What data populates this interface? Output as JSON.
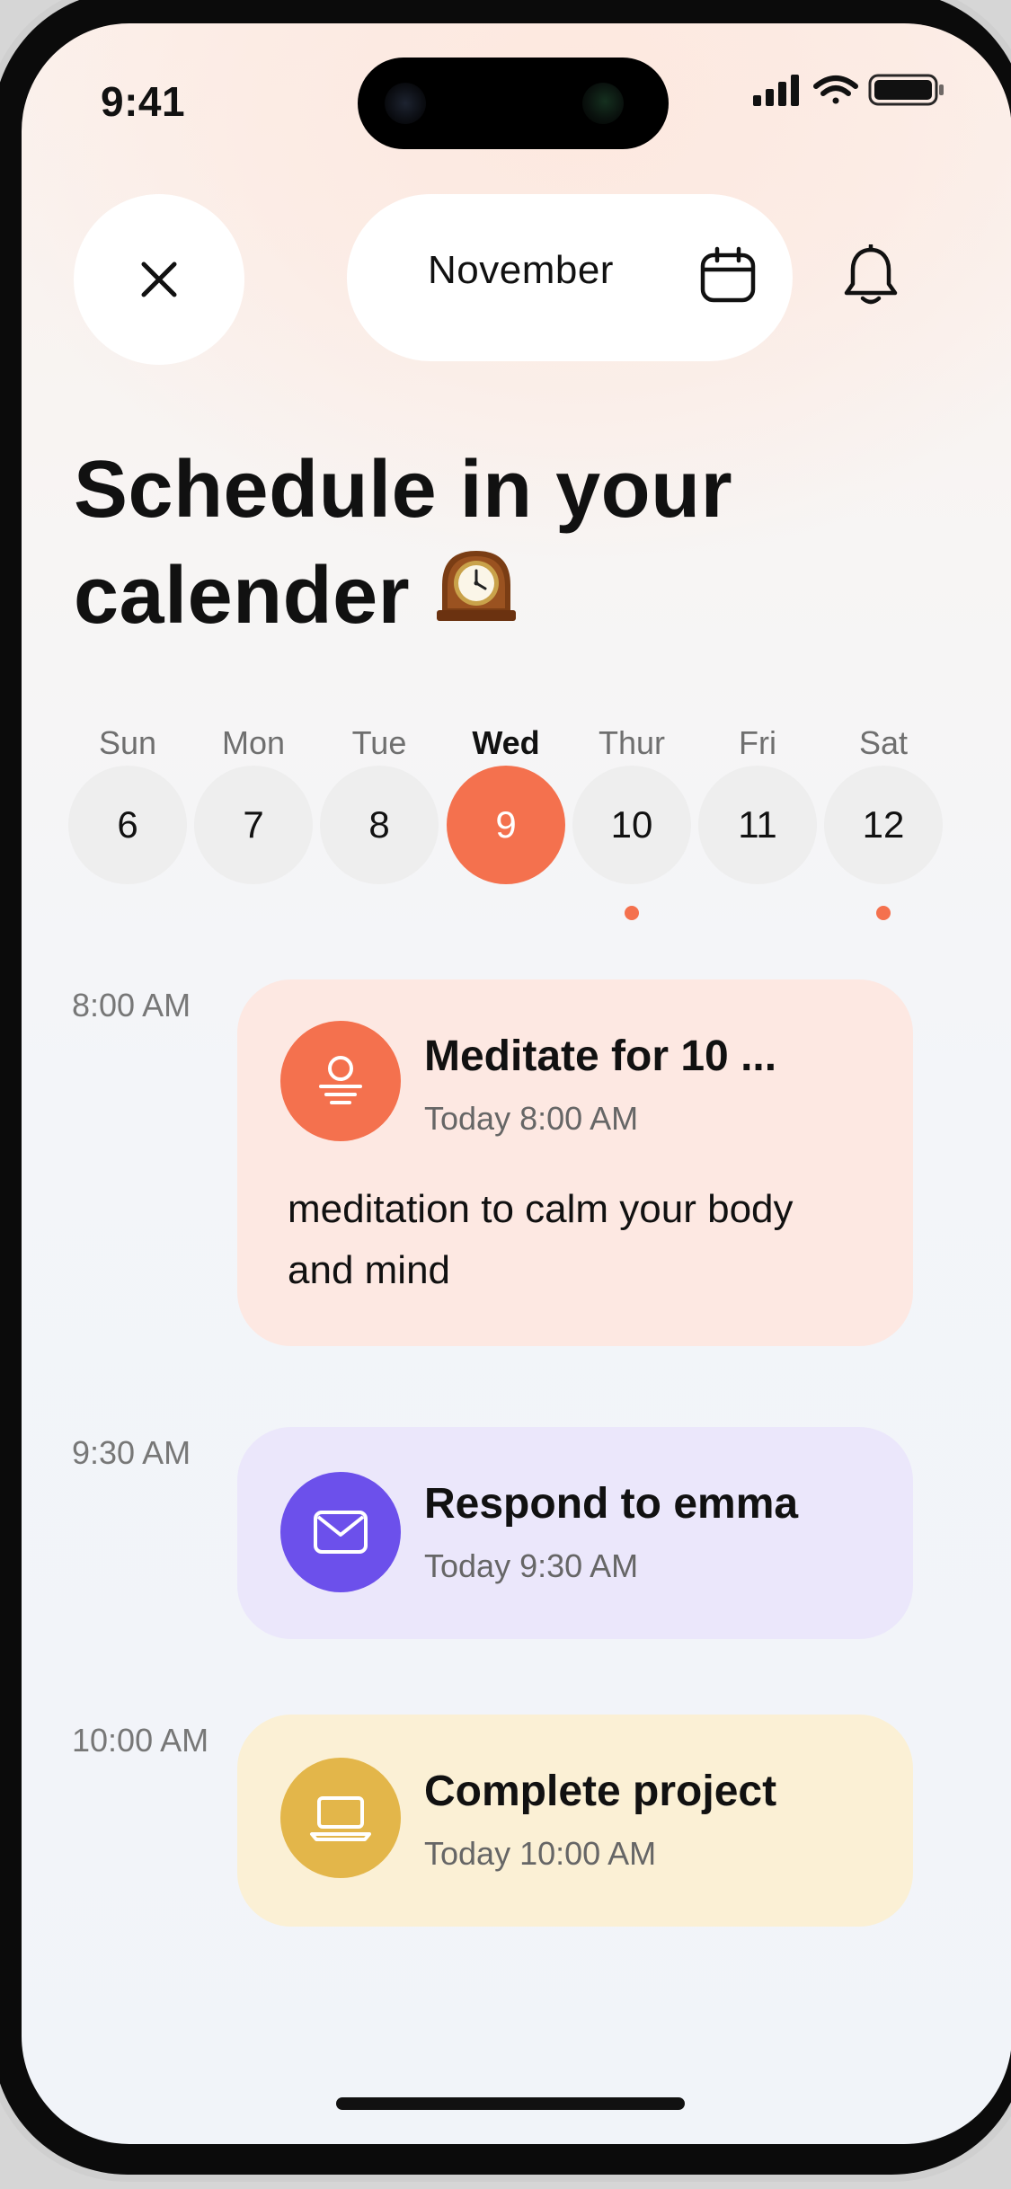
{
  "status_bar": {
    "time": "9:41"
  },
  "header": {
    "month": "November",
    "close_icon": "close-icon",
    "calendar_icon": "calendar-icon",
    "bell_icon": "bell-icon"
  },
  "title": {
    "line1": "Schedule in your",
    "line2": "calender",
    "emoji": "🕰️"
  },
  "week": {
    "days": [
      {
        "name": "Sun",
        "date": "6",
        "selected": false,
        "has_event": false
      },
      {
        "name": "Mon",
        "date": "7",
        "selected": false,
        "has_event": false
      },
      {
        "name": "Tue",
        "date": "8",
        "selected": false,
        "has_event": false
      },
      {
        "name": "Wed",
        "date": "9",
        "selected": true,
        "has_event": false
      },
      {
        "name": "Thur",
        "date": "10",
        "selected": false,
        "has_event": true
      },
      {
        "name": "Fri",
        "date": "11",
        "selected": false,
        "has_event": false
      },
      {
        "name": "Sat",
        "date": "12",
        "selected": false,
        "has_event": true
      }
    ]
  },
  "events": [
    {
      "slot": "8:00 AM",
      "title": "Meditate for 10 ...",
      "time": "Today 8:00 AM",
      "description": "meditation to calm your body and mind",
      "icon": "meditation-icon",
      "card_color": "#fde8e2",
      "icon_color": "#f4714e"
    },
    {
      "slot": "9:30 AM",
      "title": "Respond to emma",
      "time": "Today 9:30 AM",
      "icon": "mail-icon",
      "card_color": "#ebe7fb",
      "icon_color": "#6c50eb"
    },
    {
      "slot": "10:00 AM",
      "title": "Complete project",
      "time": "Today 10:00 AM",
      "icon": "laptop-icon",
      "card_color": "#fbf0d5",
      "icon_color": "#e3b64a"
    }
  ],
  "colors": {
    "accent": "#f4714e"
  }
}
